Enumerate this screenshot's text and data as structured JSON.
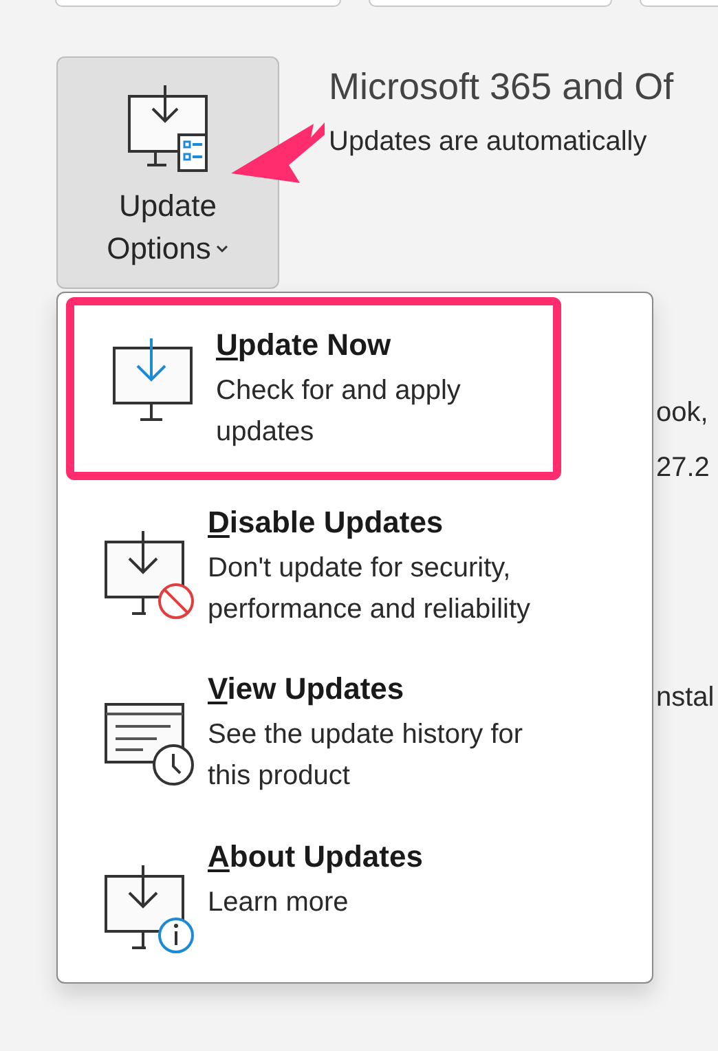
{
  "update_options_button": {
    "label_lines": [
      "Update",
      "Options"
    ],
    "has_dropdown": true
  },
  "heading": "Microsoft 365 and Of",
  "subheading": "Updates are automatically",
  "background_fragments": [
    "ook,",
    "27.2",
    "nstal"
  ],
  "callout_arrow": true,
  "menu_items": [
    {
      "kind": "download",
      "title": "Update Now",
      "mnemonic_underlined": true,
      "description": "Check for and apply updates",
      "highlighted": true
    },
    {
      "kind": "disable",
      "title": "Disable Updates",
      "mnemonic_underlined": true,
      "description": "Don't update for security, performance and reliability",
      "highlighted": false
    },
    {
      "kind": "history",
      "title": "View Updates",
      "mnemonic_underlined": true,
      "description": "See the update history for this product",
      "highlighted": false
    },
    {
      "kind": "info",
      "title": "About Updates",
      "mnemonic_underlined": true,
      "description": "Learn more",
      "highlighted": false
    }
  ]
}
